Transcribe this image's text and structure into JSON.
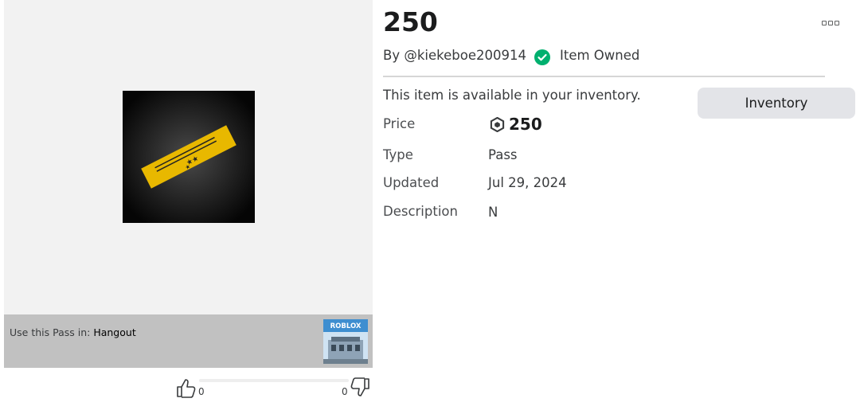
{
  "item": {
    "title": "250",
    "by_prefix": "By ",
    "creator": "@kiekeboe200914",
    "owned_label": "Item Owned",
    "availability_text": "This item is available in your inventory.",
    "inventory_button": "Inventory"
  },
  "details": {
    "price_label": "Price",
    "price_value": "250",
    "type_label": "Type",
    "type_value": "Pass",
    "updated_label": "Updated",
    "updated_value": "Jul 29, 2024",
    "description_label": "Description",
    "description_value": "N"
  },
  "place": {
    "prefix": "Use this Pass in: ",
    "name": "Hangout",
    "thumb_logo_text": "ROBLOX"
  },
  "votes": {
    "up_count": "0",
    "down_count": "0"
  },
  "colors": {
    "owned_green": "#00b06f",
    "pass_gold": "#e8b800",
    "inventory_button_bg": "#e3e4e8"
  },
  "icons": [
    "more-options-icon",
    "owned-check-icon",
    "robux-icon",
    "thumbs-up-icon",
    "thumbs-down-icon"
  ]
}
